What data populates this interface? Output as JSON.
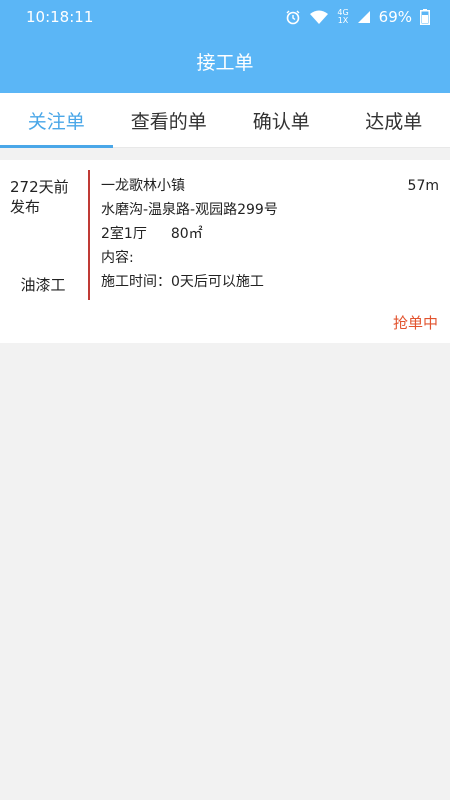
{
  "status_bar": {
    "time": "10:18:11",
    "network_top": "4G",
    "network_bottom": "1X",
    "battery": "69%",
    "icons": [
      "alarm-icon",
      "wifi-icon",
      "signal-icon",
      "battery-icon"
    ]
  },
  "header": {
    "title": "接工单"
  },
  "tabs": [
    {
      "label": "关注单"
    },
    {
      "label": "查看的单"
    },
    {
      "label": "确认单"
    },
    {
      "label": "达成单"
    }
  ],
  "order": {
    "posted": "272天前发布",
    "trade": "油漆工",
    "community": "一龙歌林小镇",
    "distance": "57m",
    "address": "水磨沟-温泉路-观园路299号",
    "layout": "2室1厅",
    "area": "80㎡",
    "content": "内容:",
    "schedule": "施工时间：0天后可以施工",
    "status": "抢单中"
  },
  "colors": {
    "header": "#5bb6f6",
    "active_tab": "#4aa7e8",
    "divider": "#c03a35",
    "status": "#e2542f"
  }
}
